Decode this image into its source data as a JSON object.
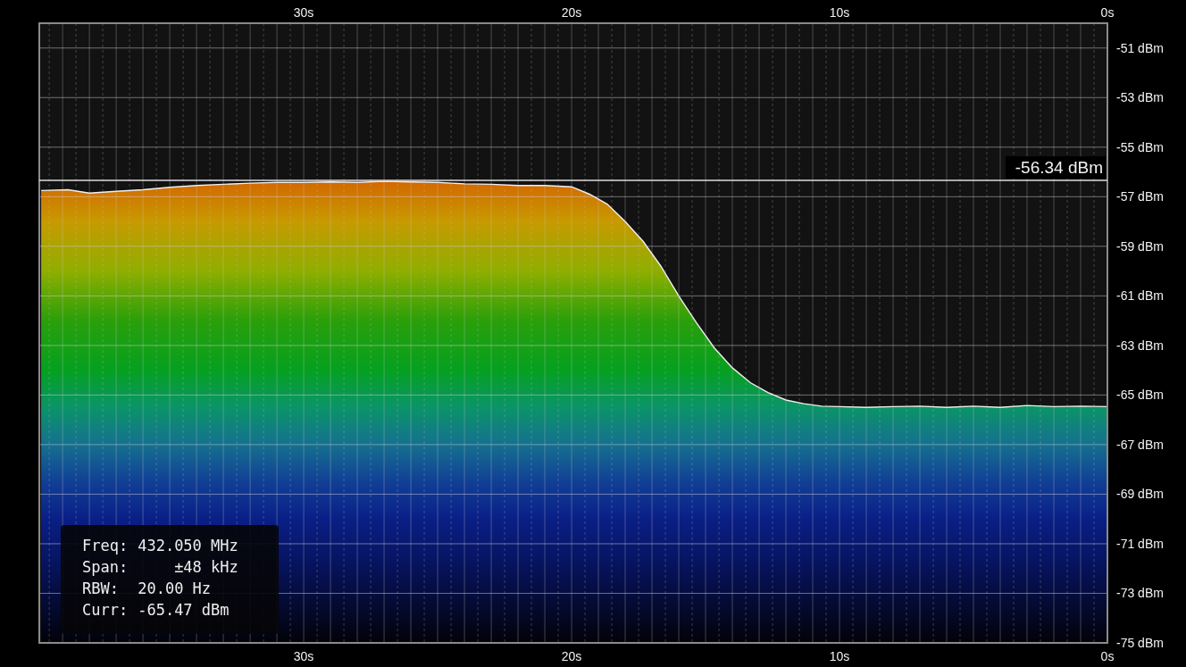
{
  "chart": {
    "top_axis_labels": [
      "30s",
      "20s",
      "10s",
      "0s"
    ],
    "chart_data": {
      "type": "area",
      "xlim": [
        39.87,
        0
      ],
      "ylim": [
        -75,
        -50
      ],
      "grid": true,
      "ref_lines": [
        {
          "axis": "y",
          "value": -56.34,
          "label": "-56.34 dBm",
          "color": "#dddddd"
        }
      ],
      "x": [
        39.8,
        38.8,
        38,
        37,
        36,
        35,
        34,
        33,
        32,
        31,
        30,
        29,
        28,
        27,
        26,
        25,
        24,
        23,
        22,
        21,
        20,
        19.33,
        18.67,
        18,
        17.33,
        16.67,
        16,
        15.33,
        14.67,
        14,
        13.33,
        12.67,
        12,
        11.33,
        10.67,
        10,
        9,
        8,
        7,
        6,
        5,
        4,
        3,
        2,
        1,
        0
      ],
      "series": [
        {
          "color": "#f0f0f0",
          "values": [
            -56.75,
            -56.72,
            -56.85,
            -56.78,
            -56.72,
            -56.62,
            -56.55,
            -56.5,
            -56.45,
            -56.42,
            -56.42,
            -56.4,
            -56.42,
            -56.38,
            -56.4,
            -56.42,
            -56.48,
            -56.5,
            -56.55,
            -56.55,
            -56.6,
            -56.9,
            -57.3,
            -58.0,
            -58.8,
            -59.8,
            -61.0,
            -62.1,
            -63.1,
            -63.9,
            -64.5,
            -64.9,
            -65.2,
            -65.35,
            -65.45,
            -65.47,
            -65.5,
            -65.47,
            -65.45,
            -65.5,
            -65.45,
            -65.5,
            -65.42,
            -65.47,
            -65.45,
            -65.47
          ]
        }
      ],
      "xticks": [
        {
          "value": 30,
          "label": "30s"
        },
        {
          "value": 20,
          "label": "20s"
        },
        {
          "value": 10,
          "label": "10s"
        },
        {
          "value": 0,
          "label": "0s"
        }
      ],
      "yticks": [
        {
          "value": -51,
          "label": "-51 dBm"
        },
        {
          "value": -53,
          "label": "-53 dBm"
        },
        {
          "value": -55,
          "label": "-55 dBm"
        },
        {
          "value": -57,
          "label": "-57 dBm"
        },
        {
          "value": -59,
          "label": "-59 dBm"
        },
        {
          "value": -61,
          "label": "-61 dBm"
        },
        {
          "value": -63,
          "label": "-63 dBm"
        },
        {
          "value": -65,
          "label": "-65 dBm"
        },
        {
          "value": -67,
          "label": "-67 dBm"
        },
        {
          "value": -69,
          "label": "-69 dBm"
        },
        {
          "value": -71,
          "label": "-71 dBm"
        },
        {
          "value": -73,
          "label": "-73 dBm"
        },
        {
          "value": -75,
          "label": "-75 dBm"
        }
      ]
    }
  },
  "info_box": [
    {
      "label": "Freq:",
      "value": "432.050 MHz"
    },
    {
      "label": "Span:",
      "value": "±48 kHz"
    },
    {
      "label": "RBW:",
      "value": "20.00 Hz"
    },
    {
      "label": "Curr:",
      "value": "-65.47 dBm"
    }
  ]
}
